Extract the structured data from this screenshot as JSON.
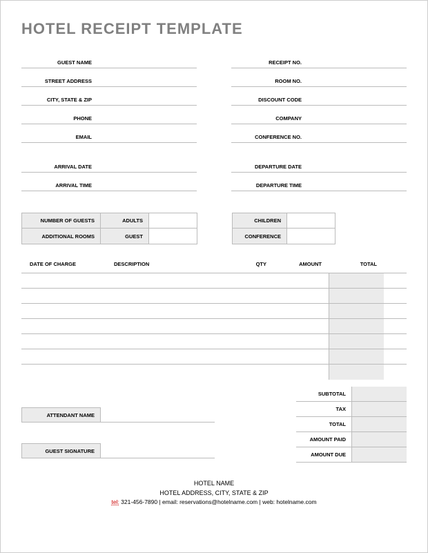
{
  "title": "HOTEL RECEIPT TEMPLATE",
  "guestInfo": {
    "left": [
      {
        "label": "GUEST NAME",
        "value": ""
      },
      {
        "label": "STREET ADDRESS",
        "value": ""
      },
      {
        "label": "CITY, STATE & ZIP",
        "value": ""
      },
      {
        "label": "PHONE",
        "value": ""
      },
      {
        "label": "EMAIL",
        "value": ""
      }
    ],
    "right": [
      {
        "label": "RECEIPT NO.",
        "value": ""
      },
      {
        "label": "ROOM NO.",
        "value": ""
      },
      {
        "label": "DISCOUNT CODE",
        "value": ""
      },
      {
        "label": "COMPANY",
        "value": ""
      },
      {
        "label": "CONFERENCE NO.",
        "value": ""
      }
    ]
  },
  "dates": {
    "left": [
      {
        "label": "ARRIVAL DATE",
        "value": ""
      },
      {
        "label": "ARRIVAL TIME",
        "value": ""
      }
    ],
    "right": [
      {
        "label": "DEPARTURE DATE",
        "value": ""
      },
      {
        "label": "DEPARTURE TIME",
        "value": ""
      }
    ]
  },
  "guestRooms": {
    "row1": {
      "numGuestsLabel": "NUMBER OF GUESTS",
      "adultsLabel": "ADULTS",
      "adultsValue": "",
      "childrenLabel": "CHILDREN",
      "childrenValue": ""
    },
    "row2": {
      "addlRoomsLabel": "ADDITIONAL ROOMS",
      "guestLabel": "GUEST",
      "guestValue": "",
      "conferenceLabel": "CONFERENCE",
      "conferenceValue": ""
    }
  },
  "charges": {
    "headers": {
      "date": "DATE OF CHARGE",
      "desc": "DESCRIPTION",
      "qty": "QTY",
      "amount": "AMOUNT",
      "total": "TOTAL"
    },
    "rows": [
      {
        "date": "",
        "desc": "",
        "qty": "",
        "amount": "",
        "total": ""
      },
      {
        "date": "",
        "desc": "",
        "qty": "",
        "amount": "",
        "total": ""
      },
      {
        "date": "",
        "desc": "",
        "qty": "",
        "amount": "",
        "total": ""
      },
      {
        "date": "",
        "desc": "",
        "qty": "",
        "amount": "",
        "total": ""
      },
      {
        "date": "",
        "desc": "",
        "qty": "",
        "amount": "",
        "total": ""
      },
      {
        "date": "",
        "desc": "",
        "qty": "",
        "amount": "",
        "total": ""
      },
      {
        "date": "",
        "desc": "",
        "qty": "",
        "amount": "",
        "total": ""
      }
    ]
  },
  "totals": {
    "subtotal": {
      "label": "SUBTOTAL",
      "value": ""
    },
    "tax": {
      "label": "TAX",
      "value": ""
    },
    "total": {
      "label": "TOTAL",
      "value": ""
    },
    "paid": {
      "label": "AMOUNT PAID",
      "value": ""
    },
    "due": {
      "label": "AMOUNT DUE",
      "value": ""
    }
  },
  "signatures": {
    "attendant": {
      "label": "ATTENDANT NAME",
      "value": ""
    },
    "guest": {
      "label": "GUEST SIGNATURE",
      "value": ""
    }
  },
  "footer": {
    "hotelName": "HOTEL NAME",
    "address": "HOTEL ADDRESS, CITY, STATE & ZIP",
    "telRed": "tel:",
    "telRest": " 321-456-7890",
    "sep": "   |   ",
    "emailLabel": "email: ",
    "email": "reservations@hotelname.com",
    "webLabel": "web: ",
    "web": "hotelname.com"
  }
}
